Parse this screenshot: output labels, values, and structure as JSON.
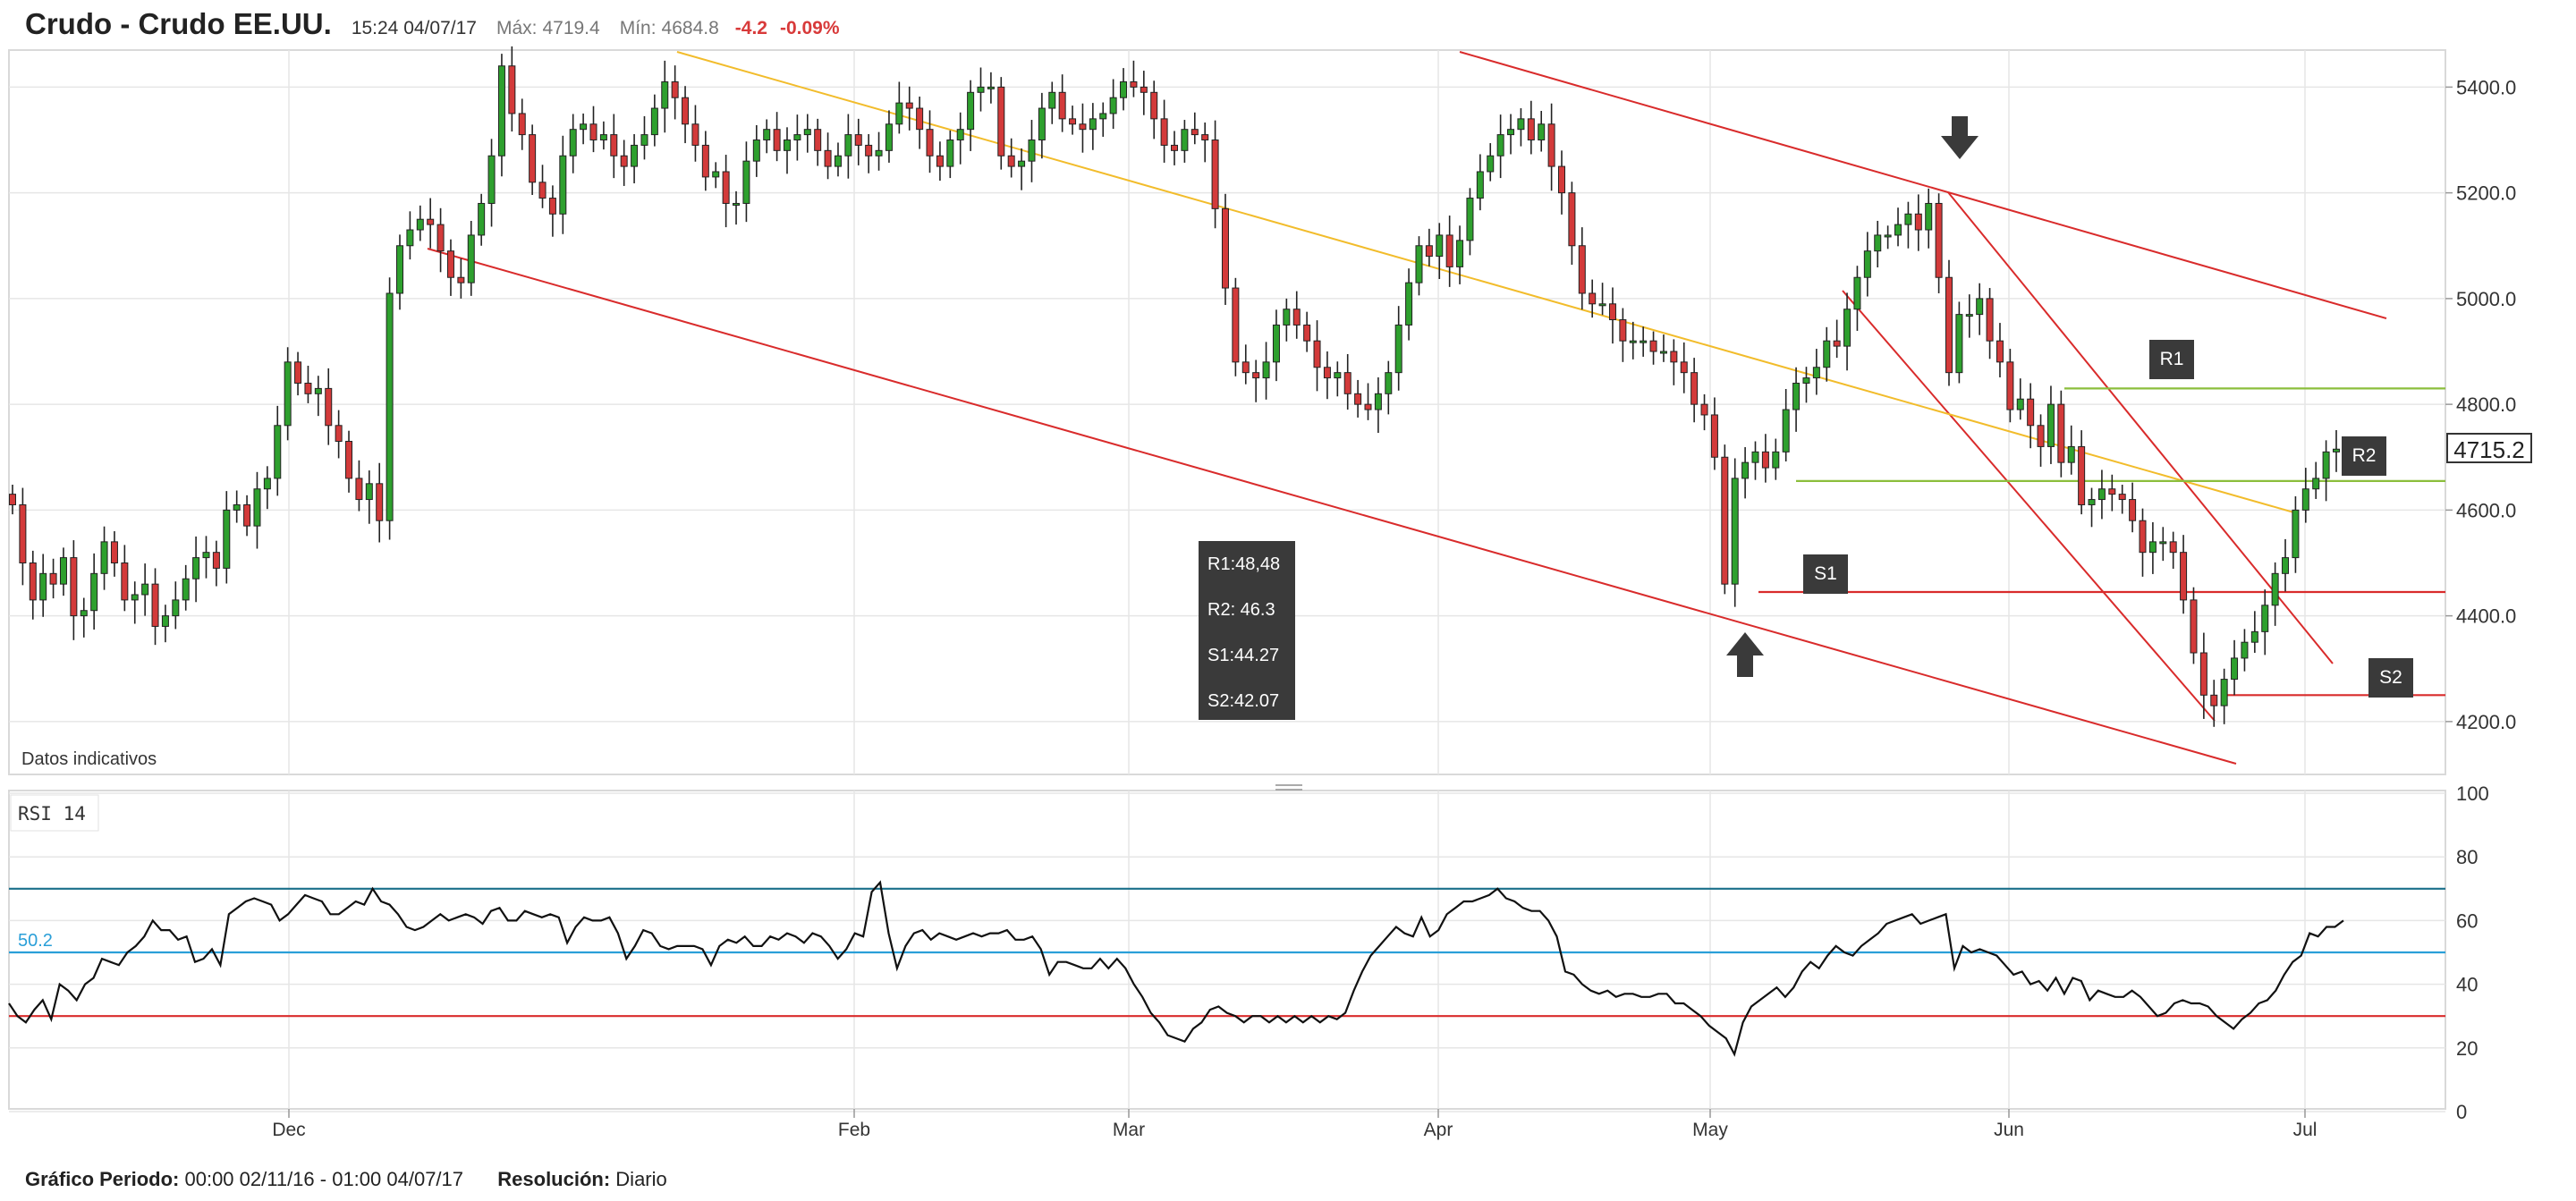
{
  "header": {
    "title": "Crudo - Crudo EE.UU.",
    "time": "15:24 04/07/17",
    "max_label": "Máx:",
    "max_value": "4719.4",
    "min_label": "Mín:",
    "min_value": "4684.8",
    "change": "-4.2",
    "change_pct": "-0.09%"
  },
  "main_chart": {
    "note": "Datos indicativos",
    "current_price_tag": "4715.2",
    "levels_box": [
      "R1:48,48",
      "R2: 46.3",
      "S1:44.27",
      "S2:42.07"
    ],
    "level_tags": {
      "r1": "R1",
      "r2": "R2",
      "s1": "S1",
      "s2": "S2"
    }
  },
  "rsi_panel": {
    "label": "RSI 14",
    "value_label": "50.2"
  },
  "footer": {
    "period_label": "Gráfico Periodo:",
    "period_value": "00:00 02/11/16 - 01:00 04/07/17",
    "resolution_label": "Resolución:",
    "resolution_value": "Diario"
  },
  "colors": {
    "up": "#2ea02e",
    "down": "#d33a3a",
    "channel": "#d92b2b",
    "trend": "#f2bc2b",
    "level_green": "#8bbe3c",
    "level_red": "#d92b2b",
    "rsi_upper": "#1a6f8a",
    "rsi_mid": "#2a9fd8",
    "rsi_lower": "#d92b2b",
    "grid": "#e6e6e6"
  },
  "chart_data": [
    {
      "type": "candlestick",
      "title": "Crudo - Crudo EE.UU.",
      "x_tick_labels": [
        "Dec",
        "Feb",
        "Mar",
        "Apr",
        "May",
        "Jun",
        "Jul"
      ],
      "y_tick_labels": [
        "5400.0",
        "5200.0",
        "5000.0",
        "4800.0",
        "4600.0",
        "4400.0",
        "4200.0"
      ],
      "ylim": [
        4100,
        5470
      ],
      "grid": true,
      "close_values": [
        4610,
        4500,
        4430,
        4480,
        4460,
        4510,
        4400,
        4410,
        4480,
        4540,
        4500,
        4430,
        4440,
        4460,
        4380,
        4400,
        4430,
        4470,
        4510,
        4520,
        4490,
        4600,
        4610,
        4570,
        4640,
        4660,
        4760,
        4880,
        4840,
        4820,
        4830,
        4760,
        4730,
        4660,
        4620,
        4650,
        4580,
        5010,
        5100,
        5130,
        5150,
        5140,
        5090,
        5040,
        5030,
        5120,
        5180,
        5270,
        5440,
        5350,
        5310,
        5220,
        5190,
        5160,
        5270,
        5320,
        5330,
        5300,
        5310,
        5270,
        5250,
        5290,
        5310,
        5360,
        5410,
        5380,
        5330,
        5290,
        5230,
        5240,
        5180,
        5180,
        5260,
        5300,
        5320,
        5280,
        5300,
        5310,
        5320,
        5280,
        5250,
        5270,
        5310,
        5290,
        5270,
        5280,
        5330,
        5370,
        5360,
        5320,
        5270,
        5250,
        5300,
        5320,
        5390,
        5400,
        5400,
        5270,
        5250,
        5260,
        5300,
        5360,
        5390,
        5340,
        5330,
        5320,
        5340,
        5350,
        5380,
        5410,
        5400,
        5390,
        5340,
        5290,
        5280,
        5320,
        5310,
        5300,
        5170,
        5020,
        4880,
        4860,
        4850,
        4880,
        4950,
        4980,
        4950,
        4920,
        4870,
        4850,
        4860,
        4820,
        4800,
        4790,
        4820,
        4860,
        4950,
        5030,
        5100,
        5080,
        5120,
        5060,
        5110,
        5190,
        5240,
        5270,
        5310,
        5320,
        5340,
        5300,
        5330,
        5250,
        5200,
        5100,
        5010,
        4990,
        4990,
        4960,
        4920,
        4920,
        4920,
        4900,
        4900,
        4880,
        4860,
        4800,
        4780,
        4700,
        4460,
        4660,
        4690,
        4710,
        4680,
        4710,
        4790,
        4840,
        4850,
        4870,
        4920,
        4910,
        4980,
        5040,
        5090,
        5120,
        5120,
        5140,
        5160,
        5130,
        5180,
        5040,
        4860,
        4970,
        4970,
        5000,
        4920,
        4880,
        4790,
        4810,
        4760,
        4720,
        4800,
        4690,
        4720,
        4610,
        4620,
        4640,
        4630,
        4620,
        4580,
        4520,
        4540,
        4540,
        4520,
        4430,
        4330,
        4250,
        4230,
        4280,
        4320,
        4350,
        4370,
        4420,
        4480,
        4510,
        4600,
        4640,
        4660,
        4710,
        4715.2
      ],
      "annotations": {
        "arrows": [
          "down-arrow-top",
          "up-arrow-bottom"
        ],
        "resistance_r1": 4830,
        "resistance_r2": 4655,
        "support_s1": 4445,
        "support_s2": 4250
      }
    },
    {
      "type": "line",
      "title": "RSI 14",
      "y_tick_labels": [
        "100",
        "80",
        "60",
        "40",
        "20",
        "0"
      ],
      "ylim": [
        0,
        100
      ],
      "levels": [
        70,
        50,
        30
      ],
      "value_label": "50.2",
      "values": [
        34,
        30,
        28,
        32,
        35,
        29,
        40,
        38,
        35,
        40,
        42,
        48,
        47,
        46,
        50,
        52,
        55,
        60,
        57,
        57,
        54,
        55,
        47,
        48,
        51,
        46,
        62,
        64,
        66,
        67,
        66,
        65,
        60,
        62,
        65,
        68,
        67,
        66,
        62,
        62,
        64,
        66,
        65,
        70,
        66,
        65,
        62,
        58,
        57,
        58,
        60,
        62,
        60,
        61,
        62,
        61,
        59,
        63,
        64,
        60,
        60,
        63,
        62,
        61,
        62,
        61,
        53,
        58,
        61,
        60,
        60,
        61,
        56,
        48,
        52,
        57,
        56,
        52,
        51,
        52,
        52,
        52,
        51,
        46,
        52,
        54,
        53,
        55,
        52,
        52,
        55,
        54,
        56,
        55,
        53,
        56,
        55,
        52,
        48,
        51,
        56,
        55,
        69,
        72,
        56,
        45,
        52,
        56,
        57,
        54,
        56,
        55,
        54,
        55,
        56,
        55,
        56,
        56,
        57,
        54,
        54,
        55,
        51,
        43,
        47,
        47,
        46,
        45,
        45,
        48,
        45,
        48,
        45,
        40,
        36,
        31,
        28,
        24,
        23,
        22,
        26,
        28,
        32,
        33,
        31,
        30,
        28,
        30,
        30,
        28,
        30,
        28,
        30,
        28,
        30,
        28,
        30,
        29,
        31,
        38,
        44,
        49,
        52,
        55,
        58,
        56,
        55,
        61,
        55,
        57,
        62,
        64,
        66,
        66,
        67,
        68,
        70,
        67,
        66,
        64,
        63,
        63,
        60,
        55,
        44,
        43,
        40,
        38,
        37,
        38,
        36,
        37,
        37,
        36,
        36,
        37,
        37,
        34,
        34,
        32,
        30,
        27,
        25,
        23,
        18,
        28,
        33,
        35,
        37,
        39,
        36,
        39,
        44,
        47,
        45,
        49,
        52,
        50,
        49,
        52,
        54,
        56,
        59,
        60,
        61,
        62,
        59,
        60,
        61,
        62,
        45,
        52,
        50,
        51,
        50,
        49,
        46,
        43,
        44,
        40,
        41,
        38,
        42,
        37,
        42,
        41,
        35,
        38,
        37,
        36,
        36,
        38,
        36,
        33,
        30,
        31,
        34,
        35,
        34,
        34,
        33,
        30,
        28,
        26,
        29,
        31,
        34,
        35,
        38,
        43,
        47,
        49,
        56,
        55,
        58,
        58,
        60
      ]
    }
  ]
}
